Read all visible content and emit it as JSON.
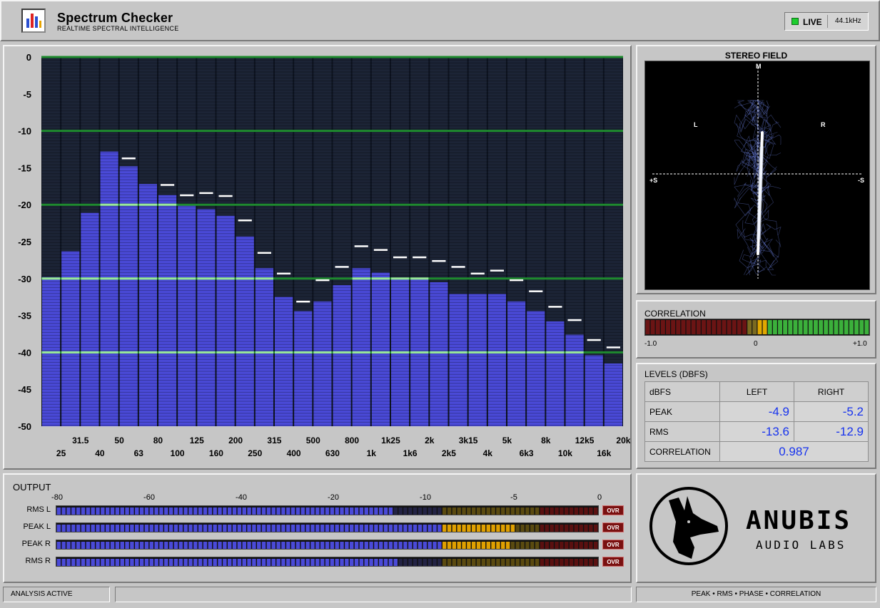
{
  "header": {
    "title": "Spectrum Checker",
    "subtitle": "REALTIME SPECTRAL INTELLIGENCE",
    "live_label": "LIVE",
    "sample_rate": "44.1kHz",
    "live_color": "#1dcd2e"
  },
  "spectrum": {
    "y_ticks": [
      "0",
      "-5",
      "-10",
      "-15",
      "-20",
      "-25",
      "-30",
      "-35",
      "-40",
      "-45",
      "-50"
    ],
    "ylim": [
      -50,
      0
    ],
    "bands": [
      "25",
      "31.5",
      "40",
      "50",
      "63",
      "80",
      "100",
      "125",
      "160",
      "200",
      "250",
      "315",
      "400",
      "500",
      "630",
      "800",
      "1k",
      "1k25",
      "1k6",
      "2k",
      "2k5",
      "3k15",
      "4k",
      "5k",
      "6k3",
      "8k",
      "10k",
      "12k5",
      "16k",
      "20k"
    ],
    "levels": [
      -29.8,
      -26.3,
      -21.1,
      -12.8,
      -14.8,
      -17.2,
      -18.7,
      -20.1,
      -20.6,
      -21.5,
      -24.3,
      -28.6,
      -32.5,
      -34.4,
      -33.1,
      -30.9,
      -28.6,
      -29.2,
      -30.0,
      -30.0,
      -30.5,
      -32.1,
      -32.1,
      -32.1,
      -33.1,
      -34.4,
      -35.8,
      -37.6,
      -40.4,
      -41.5
    ],
    "peaks": [
      null,
      null,
      null,
      null,
      -13.7,
      null,
      -17.3,
      -18.7,
      -18.4,
      -18.8,
      -22.1,
      -26.5,
      -29.3,
      -33.1,
      -30.2,
      -28.4,
      -25.6,
      -26.1,
      -27.1,
      -27.1,
      -27.6,
      -28.4,
      -29.3,
      -28.9,
      -30.2,
      -31.7,
      -33.8,
      -35.6,
      -38.3,
      -39.3
    ],
    "bar_color": "#4a4ad8",
    "bg_color": "#0d1320",
    "grid_color": "#1e8a2e",
    "peak_color": "#ffffff"
  },
  "stereo": {
    "title": "STEREO FIELD",
    "label_m": "M",
    "label_l": "L",
    "label_r": "R",
    "label_plus_s": "+S",
    "label_minus_s": "-S"
  },
  "correlation_meter": {
    "title": "CORRELATION",
    "min_label": "-1.0",
    "mid_label": "0",
    "max_label": "+1.0",
    "value": 0.987
  },
  "levels": {
    "title": "LEVELS (DBFS)",
    "col_label": "dBFS",
    "left_label": "LEFT",
    "right_label": "RIGHT",
    "peak_label": "PEAK",
    "rms_label": "RMS",
    "corr_label": "CORRELATION",
    "peak_left": "-4.9",
    "peak_right": "-5.2",
    "rms_left": "-13.6",
    "rms_right": "-12.9",
    "correlation": "0.987"
  },
  "output": {
    "title": "OUTPUT",
    "scale": [
      "-80",
      "-60",
      "-40",
      "-20",
      "-10",
      "-5",
      "0"
    ],
    "ovr_label": "OVR",
    "meters": [
      {
        "label": "RMS L",
        "level_db": -13.6
      },
      {
        "label": "PEAK L",
        "level_db": -4.9
      },
      {
        "label": "PEAK R",
        "level_db": -5.2
      },
      {
        "label": "RMS R",
        "level_db": -12.9
      }
    ]
  },
  "logo": {
    "word": "ANUBIS",
    "sub": "AUDIO LABS"
  },
  "status_bar": {
    "left": "ANALYSIS ACTIVE",
    "middle": "",
    "right": "PEAK • RMS • PHASE • CORRELATION"
  }
}
